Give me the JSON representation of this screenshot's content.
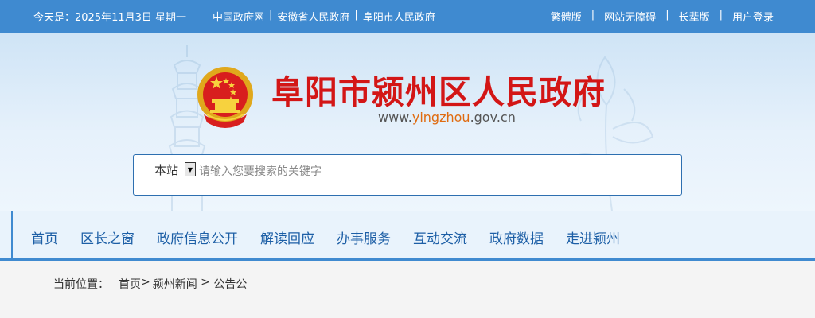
{
  "topbar": {
    "date_text": "今天是：2025年11月3日 星期一",
    "left_links": [
      {
        "label": "中国政府网"
      },
      {
        "label": "安徽省人民政府"
      },
      {
        "label": "阜阳市人民政府"
      }
    ],
    "right_links": [
      {
        "label": "繁體版"
      },
      {
        "label": "网站无障碍"
      },
      {
        "label": "长辈版"
      },
      {
        "label": "用户登录"
      }
    ],
    "separator": "|"
  },
  "header": {
    "title": "阜阳市颍州区人民政府",
    "url_prefix": "www.",
    "url_highlight": "yingzhou",
    "url_suffix": ".gov.cn"
  },
  "search": {
    "scope": "本站",
    "placeholder": "请输入您要搜索的关键字",
    "value": ""
  },
  "nav": {
    "items": [
      {
        "label": "首页"
      },
      {
        "label": "区长之窗"
      },
      {
        "label": "政府信息公开"
      },
      {
        "label": "解读回应"
      },
      {
        "label": "办事服务"
      },
      {
        "label": "互动交流"
      },
      {
        "label": "政府数据"
      },
      {
        "label": "走进颍州"
      }
    ]
  },
  "breadcrumb": {
    "label": "当前位置：",
    "items": [
      {
        "label": "首页"
      },
      {
        "label": "颍州新闻"
      },
      {
        "label": "公告公"
      }
    ],
    "sep1": ">",
    "sep2": " > "
  },
  "colors": {
    "topbar_bg": "#3f8ad0",
    "title_red": "#d31616",
    "nav_text": "#1d5fa6",
    "url_highlight": "#e06b10"
  },
  "icons": {
    "emblem": "national-emblem-icon",
    "dropdown": "dropdown-arrow-icon"
  }
}
